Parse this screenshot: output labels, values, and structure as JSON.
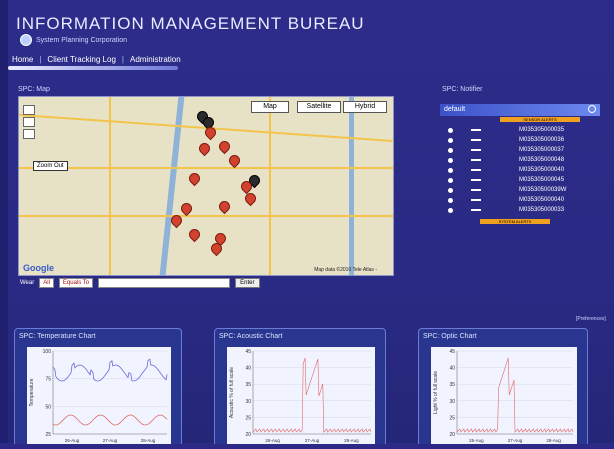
{
  "header": {
    "title": "INFORMATION MANAGEMENT BUREAU",
    "subtitle": "System Planning Corporation"
  },
  "nav": {
    "items": [
      "Home",
      "Client Tracking Log",
      "Administration"
    ]
  },
  "map_panel": {
    "label": "SPC: Map",
    "buttons": [
      "Map",
      "Satellite",
      "Hybrid"
    ],
    "zoom_out": "Zoom Out",
    "google": "Google",
    "credit": "Map data ©2010 Tele Atlas -"
  },
  "filters": {
    "field_label": "Wear",
    "field_value": "All",
    "op_value": "Equals To",
    "search_value": "",
    "button": "Enter"
  },
  "sensor_panel": {
    "label": "SPC: Notifier",
    "selected": "default",
    "sensor_alerts": "SENSOR ALERTS",
    "system_alerts": "SYSTEM ALERTS",
    "sensors": [
      "M035305000035",
      "M035305000036",
      "M035305000037",
      "M035305000048",
      "M035305000040",
      "M035305000045",
      "M03530500039W",
      "M035305000040",
      "M035305000033"
    ]
  },
  "prefs": "[Preferences]",
  "charts": [
    {
      "label": "SPC: Temperature Chart",
      "ylabel": "Temperature",
      "ticks": [
        "100",
        "75",
        "50",
        "25"
      ],
      "xticks": [
        "26-Aug",
        "27-Aug",
        "28-Aug"
      ]
    },
    {
      "label": "SPC: Acoustic Chart",
      "ylabel": "Acoustic % of full scale",
      "ticks": [
        "45",
        "40",
        "35",
        "30",
        "25",
        "20"
      ],
      "xticks": [
        "26-Aug",
        "27-Aug",
        "28-Aug"
      ]
    },
    {
      "label": "SPC: Optic Chart",
      "ylabel": "Light % of full scale",
      "ticks": [
        "45",
        "40",
        "35",
        "30",
        "25",
        "20"
      ],
      "xticks": [
        "26-Aug",
        "27-Aug",
        "28-Aug"
      ]
    }
  ],
  "colors": {
    "background": "#2c2a86",
    "accent": "#4a63d8",
    "alert": "#f0a020",
    "pin": "#d2432f",
    "series_blue": "#6a6ad8",
    "series_red": "#e06a6a"
  }
}
